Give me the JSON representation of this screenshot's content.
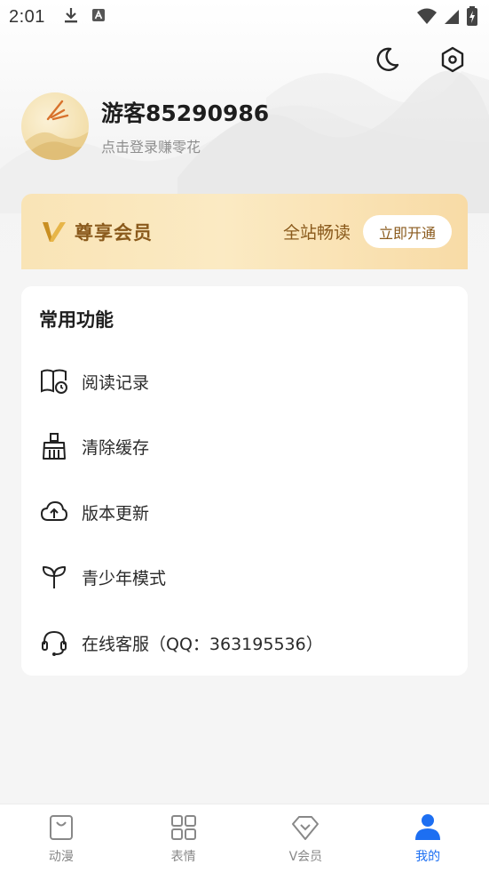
{
  "status_bar": {
    "time": "2:01"
  },
  "header": {
    "icons": {
      "night_mode": "moon-icon",
      "settings": "gear-hex-icon"
    }
  },
  "profile": {
    "username": "游客85290986",
    "login_hint": "点击登录赚零花"
  },
  "vip": {
    "title": "尊享会员",
    "slogan": "全站畅读",
    "button": "立即开通"
  },
  "functions": {
    "title": "常用功能",
    "items": [
      {
        "label": "阅读记录",
        "icon": "book-history-icon"
      },
      {
        "label": "清除缓存",
        "icon": "broom-icon"
      },
      {
        "label": "版本更新",
        "icon": "cloud-upload-icon"
      },
      {
        "label": "青少年模式",
        "icon": "sprout-icon"
      },
      {
        "label": "在线客服（QQ：363195536）",
        "icon": "headset-icon"
      }
    ]
  },
  "bottom_nav": {
    "items": [
      {
        "label": "动漫",
        "icon": "bag-icon"
      },
      {
        "label": "表情",
        "icon": "grid-icon"
      },
      {
        "label": "V会员",
        "icon": "diamond-heart-icon"
      },
      {
        "label": "我的",
        "icon": "person-icon"
      }
    ],
    "active": "我的"
  },
  "colors": {
    "accent": "#1d6ff2",
    "vip_text": "#8a5a1c",
    "vip_bg": "#fbeac3"
  }
}
